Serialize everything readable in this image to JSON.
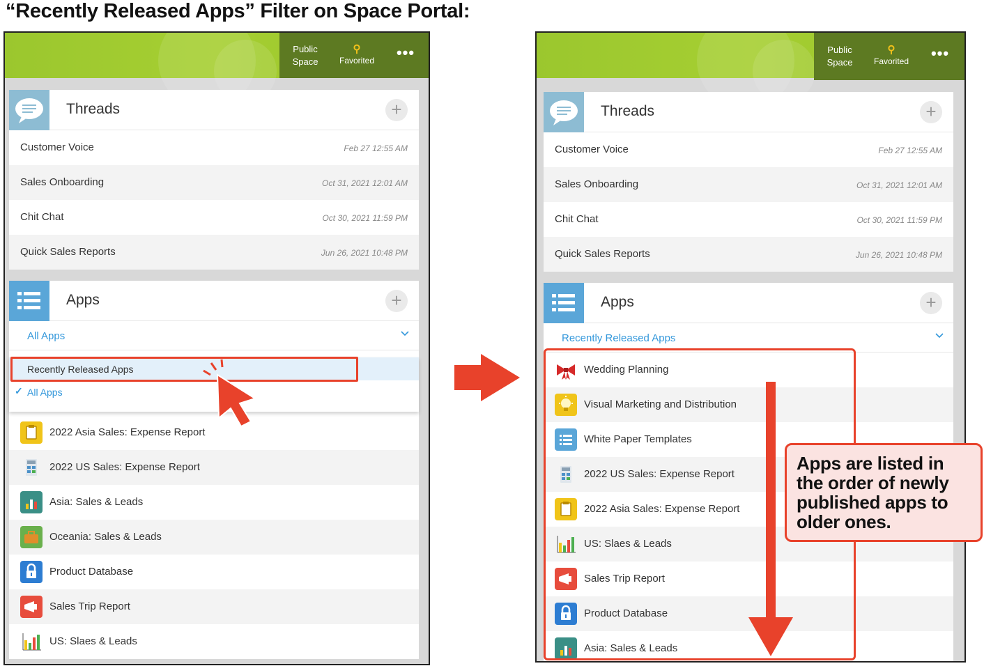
{
  "heading": "“Recently Released Apps” Filter on Space Portal:",
  "nav": {
    "public": "Public Space",
    "favorited": "Favorited",
    "more": "•••"
  },
  "threads": {
    "title": "Threads",
    "items": [
      {
        "name": "Customer Voice",
        "time": "Feb 27 12:55 AM"
      },
      {
        "name": "Sales Onboarding",
        "time": "Oct 31, 2021 12:01 AM"
      },
      {
        "name": "Chit Chat",
        "time": "Oct 30, 2021 11:59 PM"
      },
      {
        "name": "Quick Sales Reports",
        "time": "Jun 26, 2021 10:48 PM"
      }
    ]
  },
  "left": {
    "apps_title": "Apps",
    "filter": "All Apps",
    "dropdown": {
      "option_recent": "Recently Released Apps",
      "option_all": "All Apps",
      "check": "✓"
    },
    "apps": [
      {
        "name": "2022 Asia Sales: Expense Report",
        "icon": "clipboard-icon",
        "color": "#f0c419"
      },
      {
        "name": "2022 US Sales: Expense Report",
        "icon": "calculator-icon",
        "color": "#ffffff"
      },
      {
        "name": "Asia: Sales & Leads",
        "icon": "bar-chart-icon",
        "color": "#3a8f86"
      },
      {
        "name": "Oceania: Sales & Leads",
        "icon": "briefcase-icon",
        "color": "#6ab04c"
      },
      {
        "name": "Product Database",
        "icon": "lock-icon",
        "color": "#2d7dd2"
      },
      {
        "name": "Sales Trip Report",
        "icon": "megaphone-icon",
        "color": "#e74c3c"
      },
      {
        "name": "US: Slaes & Leads",
        "icon": "bar-chart-icon",
        "color": "#ffffff"
      }
    ]
  },
  "right": {
    "apps_title": "Apps",
    "filter": "Recently Released Apps",
    "apps": [
      {
        "name": "Wedding Planning",
        "icon": "ribbon-icon",
        "color": "#ffffff"
      },
      {
        "name": "Visual Marketing and Distribution",
        "icon": "lightbulb-icon",
        "color": "#f0c419"
      },
      {
        "name": "White Paper Templates",
        "icon": "list-icon",
        "color": "#5aa6d8"
      },
      {
        "name": "2022 US Sales: Expense Report",
        "icon": "calculator-icon",
        "color": "#ffffff"
      },
      {
        "name": "2022 Asia Sales: Expense Report",
        "icon": "clipboard-icon",
        "color": "#f0c419"
      },
      {
        "name": "US: Slaes & Leads",
        "icon": "bar-chart-icon",
        "color": "#ffffff"
      },
      {
        "name": "Sales Trip Report",
        "icon": "megaphone-icon",
        "color": "#e74c3c"
      },
      {
        "name": "Product Database",
        "icon": "lock-icon",
        "color": "#2d7dd2"
      },
      {
        "name": "Asia: Sales & Leads",
        "icon": "bar-chart-icon",
        "color": "#3a8f86"
      }
    ]
  },
  "callout": "Apps are listed in the order of newly published apps to older ones.",
  "colors": {
    "accent_red": "#e8422b",
    "banner_green": "#a6cf32",
    "nav_dark_green": "#5d7a22",
    "link_blue": "#3498db"
  }
}
